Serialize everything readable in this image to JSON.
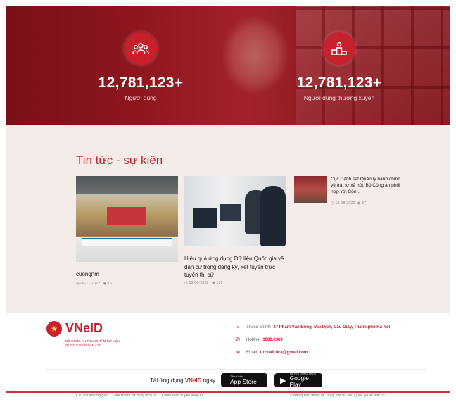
{
  "stats": [
    {
      "value": "12,781,123+",
      "label": "Người dùng",
      "icon": "users-icon"
    },
    {
      "value": "12,781,123+",
      "label": "Người dùng thường xuyên",
      "icon": "podium-icon"
    }
  ],
  "news": {
    "heading": "Tin tức - sự kiện",
    "articles": [
      {
        "title": "cuongnm",
        "date": "06-11-2022",
        "views": "16"
      },
      {
        "title": "Hiệu quả ứng dụng Dữ liệu Quốc gia về dân cư trong đăng ký, xét tuyển trực tuyến thi cử",
        "date": "18-08-2022",
        "views": "120"
      },
      {
        "title": "Cục Cảnh sát Quản lý hành chính về trật tự xã hội, Bộ Công an phối hợp với Còn...",
        "date": "18-08-2022",
        "views": "87"
      }
    ]
  },
  "footer": {
    "brand": "VNeID",
    "brand_sub": "BỘ CÔNG AN TRUNG TÂM DỮ LIỆU QUỐC GIA VỀ DÂN CƯ",
    "contacts": [
      {
        "label": "Trụ sở chính:",
        "value": "47 Phạm Văn Đồng, Mai Dịch, Cầu Giấy, Thành phố Hà Nội",
        "icon": "location-icon"
      },
      {
        "label": "Hotline:",
        "value": "1900.0368",
        "icon": "phone-icon"
      },
      {
        "label": "Email:",
        "value": "ttrcuall.bca@gmail.com",
        "icon": "mail-icon"
      }
    ],
    "download_prefix": "Tải ứng dụng",
    "download_brand": "VNeID",
    "download_suffix": "ngay",
    "app_store": {
      "small": "Tải về trên",
      "big": "App Store"
    },
    "google_play": {
      "small": "TẢI NỘI DUNG TRÊN",
      "big": "Google Play"
    },
    "bottom_links": [
      "Câu hỏi thường gặp",
      "Điều khoản sử dụng dịch vụ",
      "Chính sách quyền riêng tư"
    ],
    "copyright": "© Bản quyền thuộc về Trung tâm dữ liệu Quốc gia về dân cư"
  },
  "colors": {
    "primary": "#c61d2a",
    "hero": "#9a1b24",
    "news_bg": "#f3ece9"
  }
}
